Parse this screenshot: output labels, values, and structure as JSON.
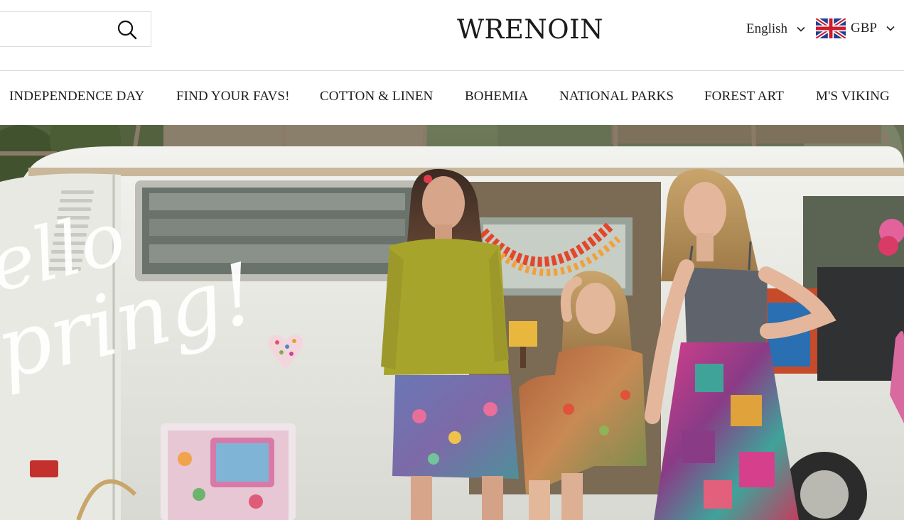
{
  "header": {
    "search": {
      "placeholder": "",
      "value": ""
    },
    "logo_text": "WRENOIN",
    "language": {
      "selected": "English"
    },
    "currency": {
      "selected": "GBP",
      "flag": "uk-flag-icon"
    }
  },
  "nav": {
    "items": [
      {
        "label": "INDEPENDENCE DAY"
      },
      {
        "label": "FIND YOUR FAVS!"
      },
      {
        "label": "COTTON & LINEN"
      },
      {
        "label": "BOHEMIA"
      },
      {
        "label": "NATIONAL PARKS"
      },
      {
        "label": "FOREST ART"
      },
      {
        "label": "M'S VIKING"
      }
    ]
  },
  "hero": {
    "script_line_1": "ello",
    "script_line_2": "pring!",
    "description_icons": [
      "heart-sticker-icon"
    ]
  },
  "colors": {
    "text": "#1a1a1a",
    "border": "#dcdcdc",
    "van_white": "#eeeeea",
    "sweater": "#a7a42c",
    "top_grey": "#5f646c",
    "garland": "#e2472a"
  }
}
